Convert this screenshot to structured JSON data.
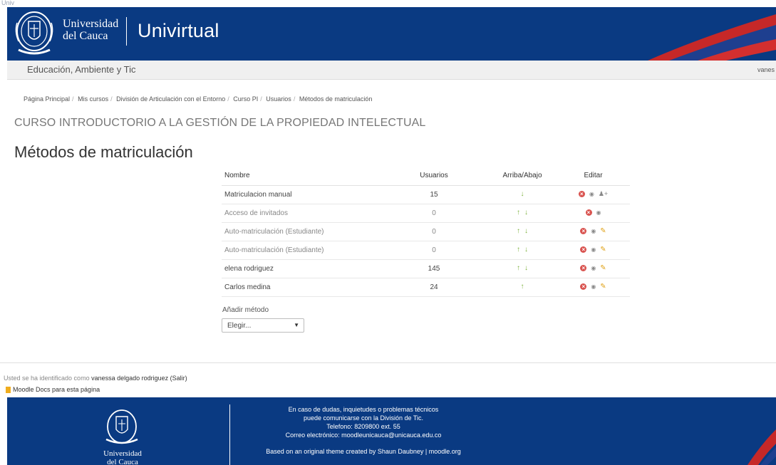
{
  "top_strip_text": "Univ",
  "header": {
    "university_line1": "Universidad",
    "university_line2": "del Cauca",
    "brand": "Univirtual"
  },
  "navbar": {
    "site_name": "Educación, Ambiente y Tic",
    "user": "vanes"
  },
  "breadcrumb": [
    "Página Principal",
    "Mis cursos",
    "División de Articulación con el Entorno",
    "Curso PI",
    "Usuarios",
    "Métodos de matriculación"
  ],
  "course_title": "CURSO INTRODUCTORIO A LA GESTIÓN DE LA PROPIEDAD INTELECTUAL",
  "page_heading": "Métodos de matriculación",
  "table": {
    "headers": {
      "name": "Nombre",
      "users": "Usuarios",
      "order": "Arriba/Abajo",
      "edit": "Editar"
    },
    "rows": [
      {
        "name": "Matriculacion manual",
        "users": "15",
        "enabled": true,
        "up": false,
        "down": true,
        "actions": [
          "delete",
          "eye",
          "enrol-users"
        ]
      },
      {
        "name": "Acceso de invitados",
        "users": "0",
        "enabled": false,
        "up": true,
        "down": true,
        "actions": [
          "delete",
          "eye"
        ]
      },
      {
        "name": "Auto-matriculación (Estudiante)",
        "users": "0",
        "enabled": false,
        "up": true,
        "down": true,
        "actions": [
          "delete",
          "eye",
          "edit"
        ]
      },
      {
        "name": "Auto-matriculación (Estudiante)",
        "users": "0",
        "enabled": false,
        "up": true,
        "down": true,
        "actions": [
          "delete",
          "eye",
          "edit"
        ]
      },
      {
        "name": "elena rodriguez",
        "users": "145",
        "enabled": true,
        "up": true,
        "down": true,
        "actions": [
          "delete",
          "eye",
          "edit"
        ]
      },
      {
        "name": "Carlos medina",
        "users": "24",
        "enabled": true,
        "up": true,
        "down": false,
        "actions": [
          "delete",
          "eye",
          "edit"
        ]
      }
    ]
  },
  "add_method": {
    "label": "Añadir método",
    "selected": "Elegir..."
  },
  "login_info": {
    "prefix": "Usted se ha identificado como ",
    "user": "vanessa delgado rodriguez",
    "logout": "(Salir)"
  },
  "docs_link": "Moodle Docs para esta página",
  "footer": {
    "university_line1": "Universidad",
    "university_line2": "del Cauca",
    "lines": [
      "En caso de dudas, inquietudes o problemas técnicos",
      "puede comunicarse con la División de Tic.",
      "Telefono: 8209800 ext. 55",
      "Correo electrónico: moodleunicauca@unicauca.edu.co"
    ],
    "credit": "Based on an original theme created by Shaun Daubney | moodle.org"
  },
  "colors": {
    "brand_blue": "#0a3a82",
    "arrow_green": "#7bb03a",
    "delete_red": "#d9534f",
    "edit_yellow": "#e0a219"
  }
}
